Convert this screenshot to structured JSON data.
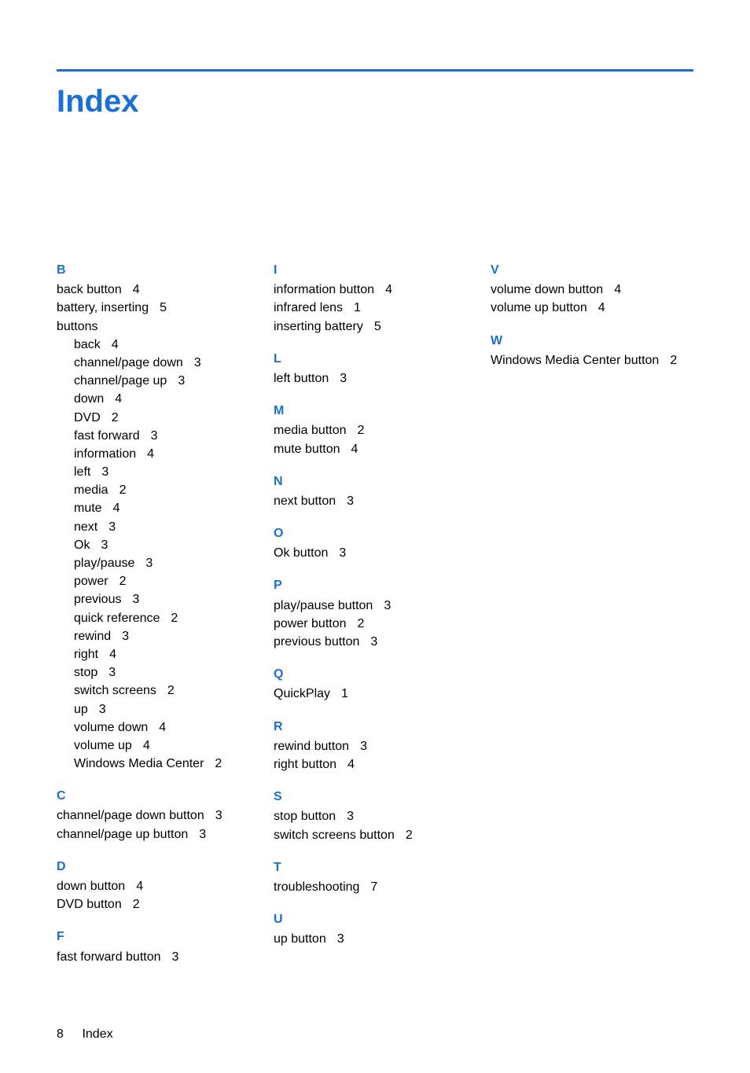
{
  "title": "Index",
  "footer": {
    "page": "8",
    "label": "Index"
  },
  "columns": [
    [
      {
        "letter": "B",
        "entries": [
          {
            "label": "back button",
            "page": "4"
          },
          {
            "label": "battery, inserting",
            "page": "5"
          },
          {
            "label": "buttons",
            "page": "",
            "sub": [
              {
                "label": "back",
                "page": "4"
              },
              {
                "label": "channel/page down",
                "page": "3"
              },
              {
                "label": "channel/page up",
                "page": "3"
              },
              {
                "label": "down",
                "page": "4"
              },
              {
                "label": "DVD",
                "page": "2"
              },
              {
                "label": "fast forward",
                "page": "3"
              },
              {
                "label": "information",
                "page": "4"
              },
              {
                "label": "left",
                "page": "3"
              },
              {
                "label": "media",
                "page": "2"
              },
              {
                "label": "mute",
                "page": "4"
              },
              {
                "label": "next",
                "page": "3"
              },
              {
                "label": "Ok",
                "page": "3"
              },
              {
                "label": "play/pause",
                "page": "3"
              },
              {
                "label": "power",
                "page": "2"
              },
              {
                "label": "previous",
                "page": "3"
              },
              {
                "label": "quick reference",
                "page": "2"
              },
              {
                "label": "rewind",
                "page": "3"
              },
              {
                "label": "right",
                "page": "4"
              },
              {
                "label": "stop",
                "page": "3"
              },
              {
                "label": "switch screens",
                "page": "2"
              },
              {
                "label": "up",
                "page": "3"
              },
              {
                "label": "volume down",
                "page": "4"
              },
              {
                "label": "volume up",
                "page": "4"
              },
              {
                "label": "Windows Media Center",
                "page": "2"
              }
            ]
          }
        ]
      },
      {
        "letter": "C",
        "entries": [
          {
            "label": "channel/page down button",
            "page": "3"
          },
          {
            "label": "channel/page up button",
            "page": "3"
          }
        ]
      },
      {
        "letter": "D",
        "entries": [
          {
            "label": "down button",
            "page": "4"
          },
          {
            "label": "DVD button",
            "page": "2"
          }
        ]
      },
      {
        "letter": "F",
        "entries": [
          {
            "label": "fast forward button",
            "page": "3"
          }
        ]
      }
    ],
    [
      {
        "letter": "I",
        "entries": [
          {
            "label": "information button",
            "page": "4"
          },
          {
            "label": "infrared lens",
            "page": "1"
          },
          {
            "label": "inserting battery",
            "page": "5"
          }
        ]
      },
      {
        "letter": "L",
        "entries": [
          {
            "label": "left button",
            "page": "3"
          }
        ]
      },
      {
        "letter": "M",
        "entries": [
          {
            "label": "media button",
            "page": "2"
          },
          {
            "label": "mute button",
            "page": "4"
          }
        ]
      },
      {
        "letter": "N",
        "entries": [
          {
            "label": "next button",
            "page": "3"
          }
        ]
      },
      {
        "letter": "O",
        "entries": [
          {
            "label": "Ok button",
            "page": "3"
          }
        ]
      },
      {
        "letter": "P",
        "entries": [
          {
            "label": "play/pause button",
            "page": "3"
          },
          {
            "label": "power button",
            "page": "2"
          },
          {
            "label": "previous button",
            "page": "3"
          }
        ]
      },
      {
        "letter": "Q",
        "entries": [
          {
            "label": "QuickPlay",
            "page": "1"
          }
        ]
      },
      {
        "letter": "R",
        "entries": [
          {
            "label": "rewind button",
            "page": "3"
          },
          {
            "label": "right button",
            "page": "4"
          }
        ]
      },
      {
        "letter": "S",
        "entries": [
          {
            "label": "stop button",
            "page": "3"
          },
          {
            "label": "switch screens button",
            "page": "2"
          }
        ]
      },
      {
        "letter": "T",
        "entries": [
          {
            "label": "troubleshooting",
            "page": "7"
          }
        ]
      },
      {
        "letter": "U",
        "entries": [
          {
            "label": "up button",
            "page": "3"
          }
        ]
      }
    ],
    [
      {
        "letter": "V",
        "entries": [
          {
            "label": "volume down button",
            "page": "4"
          },
          {
            "label": "volume up button",
            "page": "4"
          }
        ]
      },
      {
        "letter": "W",
        "entries": [
          {
            "label": "Windows Media Center button",
            "page": "2"
          }
        ]
      }
    ]
  ]
}
